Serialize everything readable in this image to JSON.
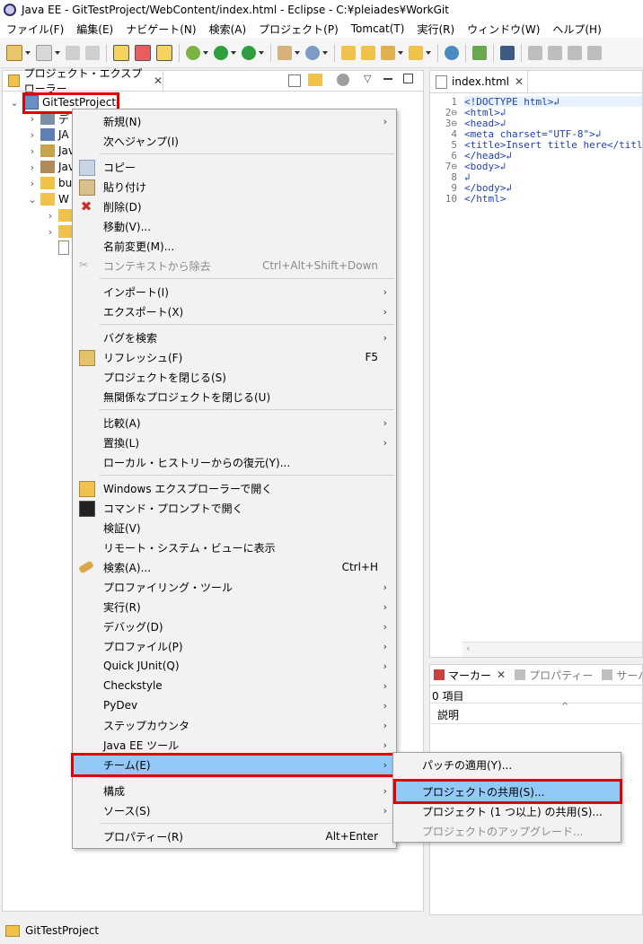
{
  "window": {
    "title": "Java EE - GitTestProject/WebContent/index.html - Eclipse - C:¥pleiades¥WorkGit"
  },
  "menubar": [
    "ファイル(F)",
    "編集(E)",
    "ナビゲート(N)",
    "検索(A)",
    "プロジェクト(P)",
    "Tomcat(T)",
    "実行(R)",
    "ウィンドウ(W)",
    "ヘルプ(H)"
  ],
  "explorer": {
    "tab_label": "プロジェクト・エクスプローラー",
    "project": "GitTestProject",
    "children": [
      {
        "label": "デ",
        "icon": "deployment-descriptor-icon"
      },
      {
        "label": "JA",
        "icon": "jax-ws-icon"
      },
      {
        "label": "Jav",
        "icon": "java-resources-icon"
      },
      {
        "label": "Jav",
        "icon": "library-icon"
      },
      {
        "label": "bu",
        "icon": "folder-icon"
      },
      {
        "label": "W",
        "icon": "folder-open-icon"
      }
    ]
  },
  "editor": {
    "tab_label": "index.html",
    "lines": [
      {
        "n": "1",
        "text": "<!DOCTYPE html>↲"
      },
      {
        "n": "2⊖",
        "text": "<html>↲"
      },
      {
        "n": "3⊖",
        "text": "<head>↲"
      },
      {
        "n": "4",
        "text": "<meta charset=\"UTF-8\">↲"
      },
      {
        "n": "5",
        "text": "<title>Insert title here</title>↲"
      },
      {
        "n": "6",
        "text": "</head>↲"
      },
      {
        "n": "7⊖",
        "text": "<body>↲"
      },
      {
        "n": "8",
        "text": "↲"
      },
      {
        "n": "9",
        "text": "</body>↲"
      },
      {
        "n": "10",
        "text": "</html>"
      }
    ]
  },
  "markers": {
    "tabs": [
      "マーカー",
      "プロパティー",
      "サーバー"
    ],
    "count": "0 項目",
    "column": "説明"
  },
  "context_menu": {
    "new": {
      "label": "新規(N)"
    },
    "goto": {
      "label": "次へジャンプ(I)"
    },
    "copy": {
      "label": "コピー"
    },
    "paste": {
      "label": "貼り付け"
    },
    "delete": {
      "label": "削除(D)"
    },
    "move": {
      "label": "移動(V)..."
    },
    "rename": {
      "label": "名前変更(M)..."
    },
    "remove_ctx": {
      "label": "コンテキストから除去",
      "shortcut": "Ctrl+Alt+Shift+Down"
    },
    "import": {
      "label": "インポート(I)"
    },
    "export": {
      "label": "エクスポート(X)"
    },
    "find_bugs": {
      "label": "バグを検索"
    },
    "refresh": {
      "label": "リフレッシュ(F)",
      "shortcut": "F5"
    },
    "close_project": {
      "label": "プロジェクトを閉じる(S)"
    },
    "close_unrelated": {
      "label": "無関係なプロジェクトを閉じる(U)"
    },
    "compare": {
      "label": "比較(A)"
    },
    "replace": {
      "label": "置換(L)"
    },
    "restore_history": {
      "label": "ローカル・ヒストリーからの復元(Y)..."
    },
    "open_explorer": {
      "label": "Windows エクスプローラーで開く"
    },
    "open_cmd": {
      "label": "コマンド・プロンプトで開く"
    },
    "validate": {
      "label": "検証(V)"
    },
    "remote_view": {
      "label": "リモート・システム・ビューに表示"
    },
    "search": {
      "label": "検索(A)...",
      "shortcut": "Ctrl+H"
    },
    "profiling": {
      "label": "プロファイリング・ツール"
    },
    "run": {
      "label": "実行(R)"
    },
    "debug": {
      "label": "デバッグ(D)"
    },
    "profile": {
      "label": "プロファイル(P)"
    },
    "quick_junit": {
      "label": "Quick JUnit(Q)"
    },
    "checkstyle": {
      "label": "Checkstyle"
    },
    "pydev": {
      "label": "PyDev"
    },
    "step_counter": {
      "label": "ステップカウンタ"
    },
    "javaee_tools": {
      "label": "Java EE ツール"
    },
    "team": {
      "label": "チーム(E)"
    },
    "configure": {
      "label": "構成"
    },
    "source": {
      "label": "ソース(S)"
    },
    "properties": {
      "label": "プロパティー(R)",
      "shortcut": "Alt+Enter"
    }
  },
  "team_submenu": {
    "apply_patch": "パッチの適用(Y)...",
    "share_project": "プロジェクトの共用(S)...",
    "share_projects": "プロジェクト (1 つ以上) の共用(S)...",
    "upgrade_project": "プロジェクトのアップグレード..."
  },
  "status": {
    "text": "GitTestProject"
  },
  "colors": {
    "highlight": "#91c9f7",
    "callout": "#e00000"
  }
}
